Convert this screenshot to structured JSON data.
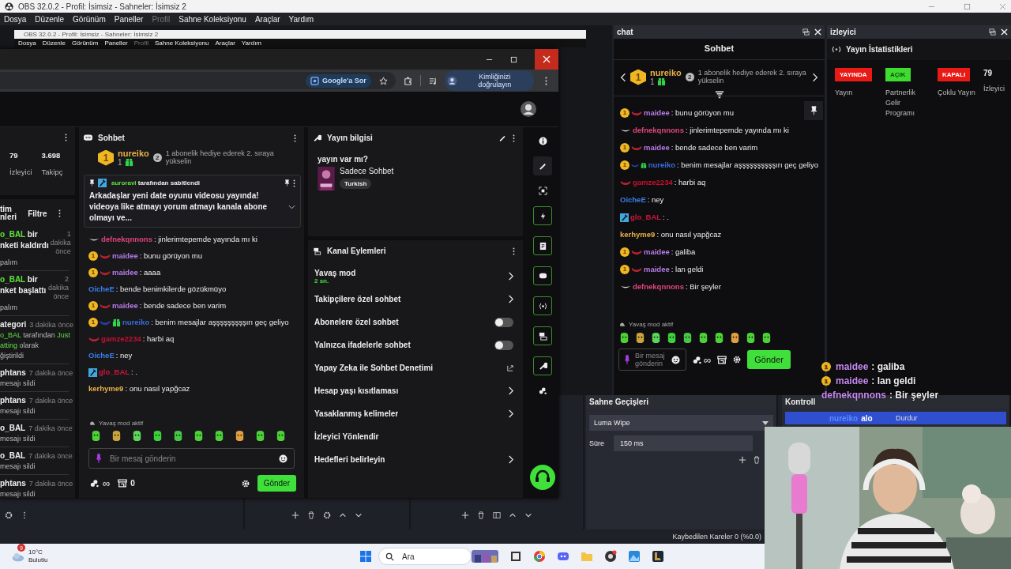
{
  "obs": {
    "title": "OBS 32.0.2 - Profil: İsimsiz - Sahneler: İsimsiz 2",
    "menu": [
      {
        "label": "Dosya",
        "disabled": false
      },
      {
        "label": "Düzenle",
        "disabled": false
      },
      {
        "label": "Görünüm",
        "disabled": false
      },
      {
        "label": "Paneller",
        "disabled": false
      },
      {
        "label": "Profil",
        "disabled": true
      },
      {
        "label": "Sahne Koleksiyonu",
        "disabled": false
      },
      {
        "label": "Araçlar",
        "disabled": false
      },
      {
        "label": "Yardım",
        "disabled": false
      }
    ],
    "status": "Kaybedilen Kareler 0 (%0.0)"
  },
  "preview": {
    "title": "OBS 32.0.2 - Profil: İsimsiz - Sahneler: İsimsiz 2",
    "menu": [
      {
        "label": "Dosya",
        "disabled": false
      },
      {
        "label": "Düzenle",
        "disabled": false
      },
      {
        "label": "Görünüm",
        "disabled": false
      },
      {
        "label": "Paneller",
        "disabled": false
      },
      {
        "label": "Profil",
        "disabled": true
      },
      {
        "label": "Sahne Koleksiyonu",
        "disabled": false
      },
      {
        "label": "Araçlar",
        "disabled": false
      },
      {
        "label": "Yardım",
        "disabled": false
      }
    ]
  },
  "browser": {
    "ask": "Google'a Sor",
    "verify": "Kimliğinizi doğrulayın"
  },
  "dashboard": {
    "stats": [
      {
        "value": "79",
        "label": "İzleyici"
      },
      {
        "value": "3.698",
        "label": "Takipç"
      }
    ],
    "activity": {
      "title": [
        "tim",
        "nleri"
      ],
      "filter": "Filtre",
      "items": [
        {
          "kind": "stacked",
          "head": [
            [
              {
                "text": "o_BAL",
                "kind": "user"
              },
              {
                "text": " bir",
                "kind": "plain"
              }
            ],
            [
              {
                "text": "nketi kaldırdı",
                "kind": "plain"
              }
            ]
          ],
          "time": "1 dakika önce",
          "body": [
            [
              {
                "text": "palım",
                "kind": "plain"
              }
            ]
          ]
        },
        {
          "kind": "stacked",
          "head": [
            [
              {
                "text": "o_BAL",
                "kind": "user"
              },
              {
                "text": " bir",
                "kind": "plain"
              }
            ],
            [
              {
                "text": "nket başlattı",
                "kind": "plain"
              }
            ]
          ],
          "time": "2 dakika önce",
          "body": [
            [
              {
                "text": "palım",
                "kind": "plain"
              }
            ]
          ]
        },
        {
          "kind": "inline",
          "head": [
            [
              {
                "text": "ategori",
                "kind": "plain"
              }
            ]
          ],
          "time": "3 dakika önce",
          "body": [
            [
              {
                "text": "o_BAL",
                "kind": "user"
              },
              {
                "text": " tarafından ",
                "kind": "plain"
              },
              {
                "text": "Just",
                "kind": "user"
              }
            ],
            [
              {
                "text": "atting",
                "kind": "user"
              },
              {
                "text": " olarak",
                "kind": "plain"
              }
            ],
            [
              {
                "text": "ğiştirildi",
                "kind": "plain"
              }
            ]
          ]
        },
        {
          "kind": "inline",
          "head": [
            [
              {
                "text": "phtans",
                "kind": "plain"
              }
            ]
          ],
          "time": "7 dakika önce",
          "body": [
            [
              {
                "text": "mesajı sildi",
                "kind": "plain"
              }
            ]
          ]
        },
        {
          "kind": "inline",
          "head": [
            [
              {
                "text": "phtans",
                "kind": "plain"
              }
            ]
          ],
          "time": "7 dakika önce",
          "body": [
            [
              {
                "text": "mesajı sildi",
                "kind": "plain"
              }
            ]
          ]
        },
        {
          "kind": "inline",
          "head": [
            [
              {
                "text": "o_BAL",
                "kind": "plain"
              }
            ]
          ],
          "time": "7 dakika önce",
          "body": [
            [
              {
                "text": "mesajı sildi",
                "kind": "plain"
              }
            ]
          ]
        },
        {
          "kind": "inline",
          "head": [
            [
              {
                "text": "o_BAL",
                "kind": "plain"
              }
            ]
          ],
          "time": "7 dakika önce",
          "body": [
            [
              {
                "text": "mesajı sildi",
                "kind": "plain"
              }
            ]
          ]
        },
        {
          "kind": "inline",
          "head": [
            [
              {
                "text": "phtans",
                "kind": "plain"
              }
            ]
          ],
          "time": "7 dakika önce",
          "body": [
            [
              {
                "text": "mesajı sildi",
                "kind": "plain"
              }
            ]
          ]
        }
      ]
    },
    "chat": {
      "title": "Sohbet",
      "leader": {
        "rank": "1",
        "name": "nureiko",
        "count": "1",
        "gift_rank": "2",
        "gift_text": "1 abonelik hediye ederek 2. sıraya yükselin"
      },
      "pinned": {
        "by": "auroravl",
        "by_rest": "tarafından sabitlendi",
        "text": "Arkadaşlar yeni date oyunu videosu yayında! videoya like atmayı yorum atmayı kanala abone olmayı ve..."
      },
      "messages": [
        {
          "badges": [
            {
              "kind": "chevron"
            }
          ],
          "user": "defnekqnnons",
          "color": "#e0457b",
          "text": ": jinlerimtepemde yayında mı ki"
        },
        {
          "badges": [
            {
              "kind": "sub",
              "text": "1"
            },
            {
              "kind": "wave",
              "color": "#b8232f"
            }
          ],
          "user": "maidee",
          "color": "#b77be8",
          "text": ": bunu görüyon mu"
        },
        {
          "badges": [
            {
              "kind": "sub",
              "text": "1"
            },
            {
              "kind": "wave",
              "color": "#b8232f"
            }
          ],
          "user": "maidee",
          "color": "#b77be8",
          "text": ": aaaa"
        },
        {
          "user": "OicheE",
          "color": "#3b7de8",
          "text": ": bende benimkilerde gözükmüyo"
        },
        {
          "badges": [
            {
              "kind": "sub",
              "text": "1"
            },
            {
              "kind": "wave",
              "color": "#b8232f"
            }
          ],
          "user": "maidee",
          "color": "#b77be8",
          "text": ": bende sadece ben varim"
        },
        {
          "badges": [
            {
              "kind": "sub",
              "text": "1"
            },
            {
              "kind": "wave",
              "color": "#2a3fa8"
            },
            {
              "kind": "gift"
            }
          ],
          "user": "nureiko",
          "color": "#3a6bdc",
          "text": ": benim mesajlar aşşşşşşşşşırı geç geliyo"
        },
        {
          "badges": [
            {
              "kind": "wave",
              "color": "#b8232f"
            }
          ],
          "user": "gamze2234",
          "color": "#c8102e",
          "text": ": harbi aq"
        },
        {
          "user": "OicheE",
          "color": "#3b7de8",
          "text": ": ney"
        },
        {
          "badges": [
            {
              "kind": "mod"
            }
          ],
          "user": "glo_BAL",
          "color": "#d0143c",
          "text": ": ."
        },
        {
          "user": "kerhyme9",
          "color": "#e8b04a",
          "text": ": onu nasıl yapğcaz"
        }
      ],
      "slow": "Yavaş mod aktif",
      "placeholder": "Bir mesaj gönderin",
      "points": "∞",
      "store": "0",
      "send": "Gönder"
    },
    "info": {
      "title": "Yayın bilgisi",
      "stream_title": "yayın var mı?",
      "category": "Sadece Sohbet",
      "tag": "Turkish"
    },
    "actions": {
      "title": "Kanal Eylemleri",
      "items": [
        {
          "kind": "link",
          "label": "Yavaş mod",
          "sub": "2 sn."
        },
        {
          "kind": "link",
          "label": "Takipçilere özel sohbet"
        },
        {
          "kind": "toggle",
          "label": "Abonelere özel sohbet",
          "on": false
        },
        {
          "kind": "toggle",
          "label": "Yalnızca ifadelerle sohbet",
          "on": false
        },
        {
          "kind": "external",
          "label": "Yapay Zeka ile Sohbet Denetimi"
        },
        {
          "kind": "link",
          "label": "Hesap yaşı kısıtlaması"
        },
        {
          "kind": "link",
          "label": "Yasaklanmış kelimeler"
        },
        {
          "kind": "plain",
          "label": "İzleyici Yönlendir"
        },
        {
          "kind": "link",
          "label": "Hedefleri belirleyin"
        }
      ]
    }
  },
  "chat_dock": {
    "title": "chat",
    "header": "Sohbet",
    "leader": {
      "rank": "1",
      "name": "nureiko",
      "count": "1",
      "gift_rank": "2",
      "gift_text": "1 abonelik hediye ederek 2. sıraya yükselin"
    },
    "messages": [
      {
        "badges": [
          {
            "kind": "sub",
            "text": "1"
          },
          {
            "kind": "wave",
            "color": "#b8232f"
          }
        ],
        "user": "maidee",
        "color": "#b77be8",
        "text": ": bunu görüyon mu"
      },
      {
        "badges": [
          {
            "kind": "chevron"
          }
        ],
        "user": "defnekqnnons",
        "color": "#e0457b",
        "text": ": jinlerimtepemde yayında mı ki"
      },
      {
        "badges": [
          {
            "kind": "sub",
            "text": "1"
          },
          {
            "kind": "wave",
            "color": "#b8232f"
          }
        ],
        "user": "maidee",
        "color": "#b77be8",
        "text": ": bende sadece ben varim"
      },
      {
        "badges": [
          {
            "kind": "sub",
            "text": "1"
          },
          {
            "kind": "wave",
            "color": "#2a3fa8"
          },
          {
            "kind": "gift"
          }
        ],
        "user": "nureiko",
        "color": "#3a6bdc",
        "text": ": benim mesajlar aşşşşşşşşşşırı geç geliyo"
      },
      {
        "badges": [
          {
            "kind": "wave",
            "color": "#b8232f"
          }
        ],
        "user": "gamze2234",
        "color": "#c8102e",
        "text": ": harbi aq"
      },
      {
        "user": "OicheE",
        "color": "#3b7de8",
        "text": ": ney"
      },
      {
        "badges": [
          {
            "kind": "mod"
          }
        ],
        "user": "glo_BAL",
        "color": "#d0143c",
        "text": ": ."
      },
      {
        "user": "kerhyme9",
        "color": "#e8b04a",
        "text": ": onu nasıl yapğcaz"
      },
      {
        "badges": [
          {
            "kind": "sub",
            "text": "1"
          },
          {
            "kind": "wave",
            "color": "#b8232f"
          }
        ],
        "user": "maidee",
        "color": "#b77be8",
        "text": ": galiba"
      },
      {
        "badges": [
          {
            "kind": "sub",
            "text": "1"
          },
          {
            "kind": "wave",
            "color": "#b8232f"
          }
        ],
        "user": "maidee",
        "color": "#b77be8",
        "text": ": lan geldi"
      },
      {
        "badges": [
          {
            "kind": "chevron"
          }
        ],
        "user": "defnekqnnons",
        "color": "#e0457b",
        "text": ": Bir şeyler"
      }
    ],
    "slow": "Yavaş mod aktif",
    "placeholder": "Bir mesaj gönderin",
    "points": "∞",
    "send": "Gönder"
  },
  "viewer_dock": {
    "title": "izleyici",
    "header": "Yayın İstatistikleri",
    "stats": [
      {
        "kind": "badge",
        "badge": "YAYINDA",
        "color": "#e91916",
        "label": "Yayın"
      },
      {
        "kind": "badge",
        "badge": "AÇIK",
        "color": "#3ddc2f",
        "label": "Partnerlik Gelir Programı"
      },
      {
        "kind": "badge",
        "badge": "KAPALI",
        "color": "#e91916",
        "label": "Çoklu Yayın"
      },
      {
        "kind": "number",
        "value": "79",
        "label": "İzleyici"
      }
    ]
  },
  "overlay": [
    {
      "badges": [
        {
          "kind": "sub",
          "text": "1"
        }
      ],
      "user": "maidee",
      "text": ": galiba"
    },
    {
      "badges": [
        {
          "kind": "sub",
          "text": "1"
        }
      ],
      "user": "maidee",
      "text": ": lan geldi"
    },
    {
      "user": "defnekqnnons",
      "text": ": Bir şeyler"
    }
  ],
  "transitions": {
    "title": "Sahne Geçişleri",
    "transition": "Luma Wipe",
    "duration_label": "Süre",
    "duration": "150 ms"
  },
  "controls": {
    "title": "Kontroll",
    "button": "Durdur",
    "overlay_user": "nureiko",
    "overlay_text": "alo"
  },
  "taskbar": {
    "weather_badge": "9",
    "temp": "10°C",
    "condition": "Bulutlu",
    "search": "Ara"
  }
}
